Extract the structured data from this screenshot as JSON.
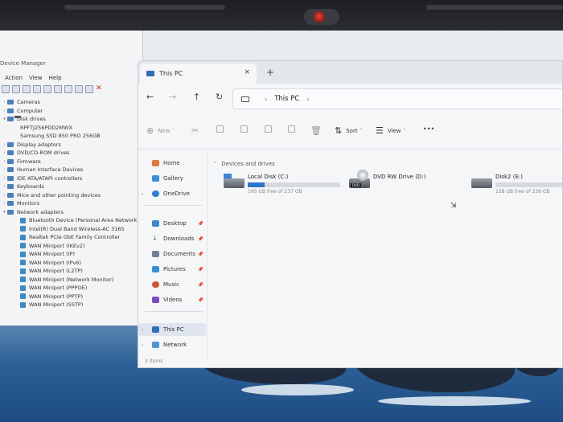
{
  "device_manager": {
    "title": "Device Manager",
    "menu": [
      "Action",
      "View",
      "Help"
    ],
    "tree": [
      {
        "label": "Cameras",
        "expanded": false,
        "level": 0,
        "icon": "camera-icon"
      },
      {
        "label": "Computer",
        "expanded": false,
        "level": 0,
        "icon": "computer-icon"
      },
      {
        "label": "Disk drives",
        "expanded": true,
        "level": 0,
        "icon": "disk-icon"
      },
      {
        "label": "RPFTJ256PDD2MWX",
        "level": 1,
        "icon": "drive-icon"
      },
      {
        "label": "Samsung SSD 850 PRO 256GB",
        "level": 1,
        "icon": "drive-icon"
      },
      {
        "label": "Display adaptors",
        "expanded": false,
        "level": 0,
        "icon": "display-icon"
      },
      {
        "label": "DVD/CD-ROM drives",
        "expanded": false,
        "level": 0,
        "icon": "dvd-icon"
      },
      {
        "label": "Firmware",
        "expanded": false,
        "level": 0,
        "icon": "firmware-icon"
      },
      {
        "label": "Human Interface Devices",
        "expanded": false,
        "level": 0,
        "icon": "hid-icon"
      },
      {
        "label": "IDE ATA/ATAPI controllers",
        "expanded": false,
        "level": 0,
        "icon": "ide-icon"
      },
      {
        "label": "Keyboards",
        "expanded": false,
        "level": 0,
        "icon": "keyboard-icon"
      },
      {
        "label": "Mice and other pointing devices",
        "expanded": false,
        "level": 0,
        "icon": "mouse-icon"
      },
      {
        "label": "Monitors",
        "expanded": false,
        "level": 0,
        "icon": "monitor-icon"
      },
      {
        "label": "Network adapters",
        "expanded": true,
        "level": 0,
        "icon": "network-icon"
      },
      {
        "label": "Bluetooth Device (Personal Area Network)",
        "level": 1,
        "icon": "network-adapter-icon"
      },
      {
        "label": "Intel(R) Dual Band Wireless-AC 3165",
        "level": 1,
        "icon": "network-adapter-icon"
      },
      {
        "label": "Realtek PCIe GbE Family Controller",
        "level": 1,
        "icon": "network-adapter-icon"
      },
      {
        "label": "WAN Miniport (IKEv2)",
        "level": 1,
        "icon": "network-adapter-icon"
      },
      {
        "label": "WAN Miniport (IP)",
        "level": 1,
        "icon": "network-adapter-icon"
      },
      {
        "label": "WAN Miniport (IPv6)",
        "level": 1,
        "icon": "network-adapter-icon"
      },
      {
        "label": "WAN Miniport (L2TP)",
        "level": 1,
        "icon": "network-adapter-icon"
      },
      {
        "label": "WAN Miniport (Network Monitor)",
        "level": 1,
        "icon": "network-adapter-icon"
      },
      {
        "label": "WAN Miniport (PPPOE)",
        "level": 1,
        "icon": "network-adapter-icon"
      },
      {
        "label": "WAN Miniport (PPTP)",
        "level": 1,
        "icon": "network-adapter-icon"
      },
      {
        "label": "WAN Miniport (SSTP)",
        "level": 1,
        "icon": "network-adapter-icon"
      }
    ]
  },
  "explorer": {
    "tab_title": "This PC",
    "new_tab": "+",
    "close_tab": "×",
    "breadcrumb": {
      "location": "This PC"
    },
    "nav": {
      "back": "←",
      "forward": "→",
      "up": "↑",
      "refresh": "↻"
    },
    "commands": {
      "new_label": "New",
      "sort_label": "Sort",
      "view_label": "View",
      "more_label": "•••"
    },
    "nav_pane": {
      "home": "Home",
      "gallery": "Gallery",
      "onedrive": "OneDrive",
      "quick": [
        "Desktop",
        "Downloads",
        "Documents",
        "Pictures",
        "Music",
        "Videos"
      ],
      "this_pc": "This PC",
      "network": "Network"
    },
    "section_header": "Devices and drives",
    "drives": [
      {
        "name": "Local Disk (C:)",
        "free_text": "195 GB free of 237 GB",
        "used_fraction": 0.18,
        "icon": "windows-drive-icon"
      },
      {
        "name": "DVD RW Drive (D:)",
        "free_text": "",
        "icon": "dvd-drive-icon",
        "badge": "DVD"
      },
      {
        "name": "Disk2 (E:)",
        "free_text": "238 GB free of 238 GB",
        "used_fraction": 0.0,
        "icon": "drive-icon"
      }
    ],
    "status": "3 items"
  },
  "colors": {
    "accent": "#2b76c9",
    "close_red": "#c0281c"
  }
}
